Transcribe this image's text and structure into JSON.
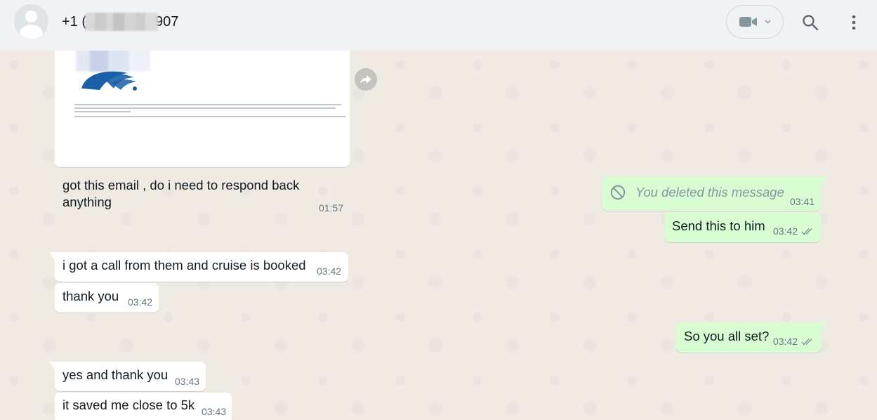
{
  "header": {
    "contact_prefix": "+1 (",
    "contact_suffix": "907",
    "icons": {
      "avatar": "default-avatar-icon",
      "video": "video-camera-icon",
      "dropdown": "chevron-down-icon",
      "search": "search-icon",
      "menu": "kebab-menu-icon"
    }
  },
  "messages": [
    {
      "id": "m1",
      "direction": "in",
      "type": "image_with_caption",
      "text_line1": "got this email , do i need to respond back",
      "text_line2": "anything",
      "time": "01:57"
    },
    {
      "id": "m2",
      "direction": "out",
      "type": "deleted",
      "text": "You deleted this message",
      "time": "03:41"
    },
    {
      "id": "m3",
      "direction": "out",
      "type": "text",
      "text": "Send this to him",
      "time": "03:42",
      "status": "read"
    },
    {
      "id": "m4",
      "direction": "in",
      "type": "text",
      "text": "i got a call from them and cruise is booked",
      "time": "03:42"
    },
    {
      "id": "m5",
      "direction": "in",
      "type": "text",
      "text": "thank you",
      "time": "03:42"
    },
    {
      "id": "m6",
      "direction": "out",
      "type": "text",
      "text": "So you all set?",
      "time": "03:42",
      "status": "read"
    },
    {
      "id": "m7",
      "direction": "in",
      "type": "text",
      "text": "yes and thank you",
      "time": "03:43"
    },
    {
      "id": "m8",
      "direction": "in",
      "type": "text",
      "text": "it saved me close to 5k",
      "time": "03:43"
    }
  ],
  "colors": {
    "header_bg": "#f0f2f5",
    "chat_bg": "#efeae2",
    "incoming_bubble": "#ffffff",
    "outgoing_bubble": "#d9fdd3",
    "timestamp": "#667781",
    "read_ticks": "#8696a0",
    "email_logo": "#1a5fa8"
  }
}
